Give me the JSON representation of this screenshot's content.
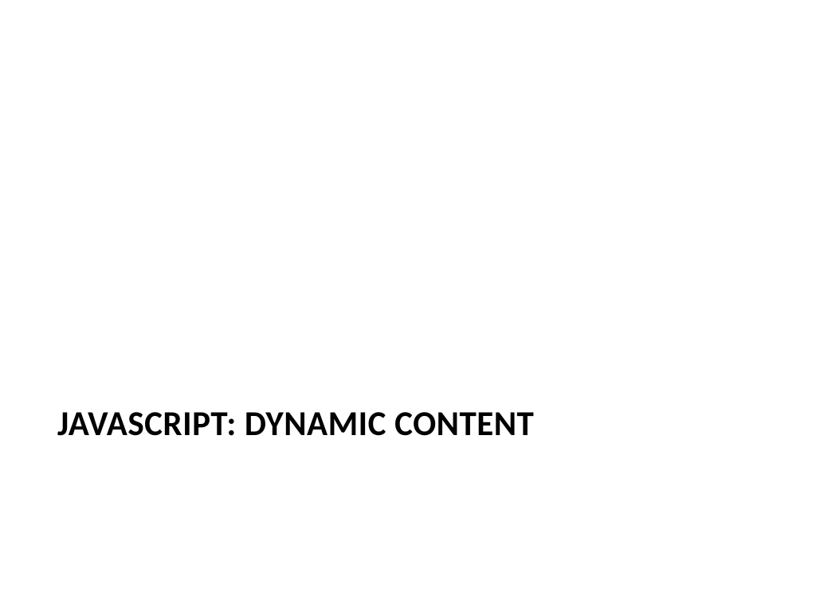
{
  "slide": {
    "title": "JAVASCRIPT: DYNAMIC CONTENT"
  }
}
